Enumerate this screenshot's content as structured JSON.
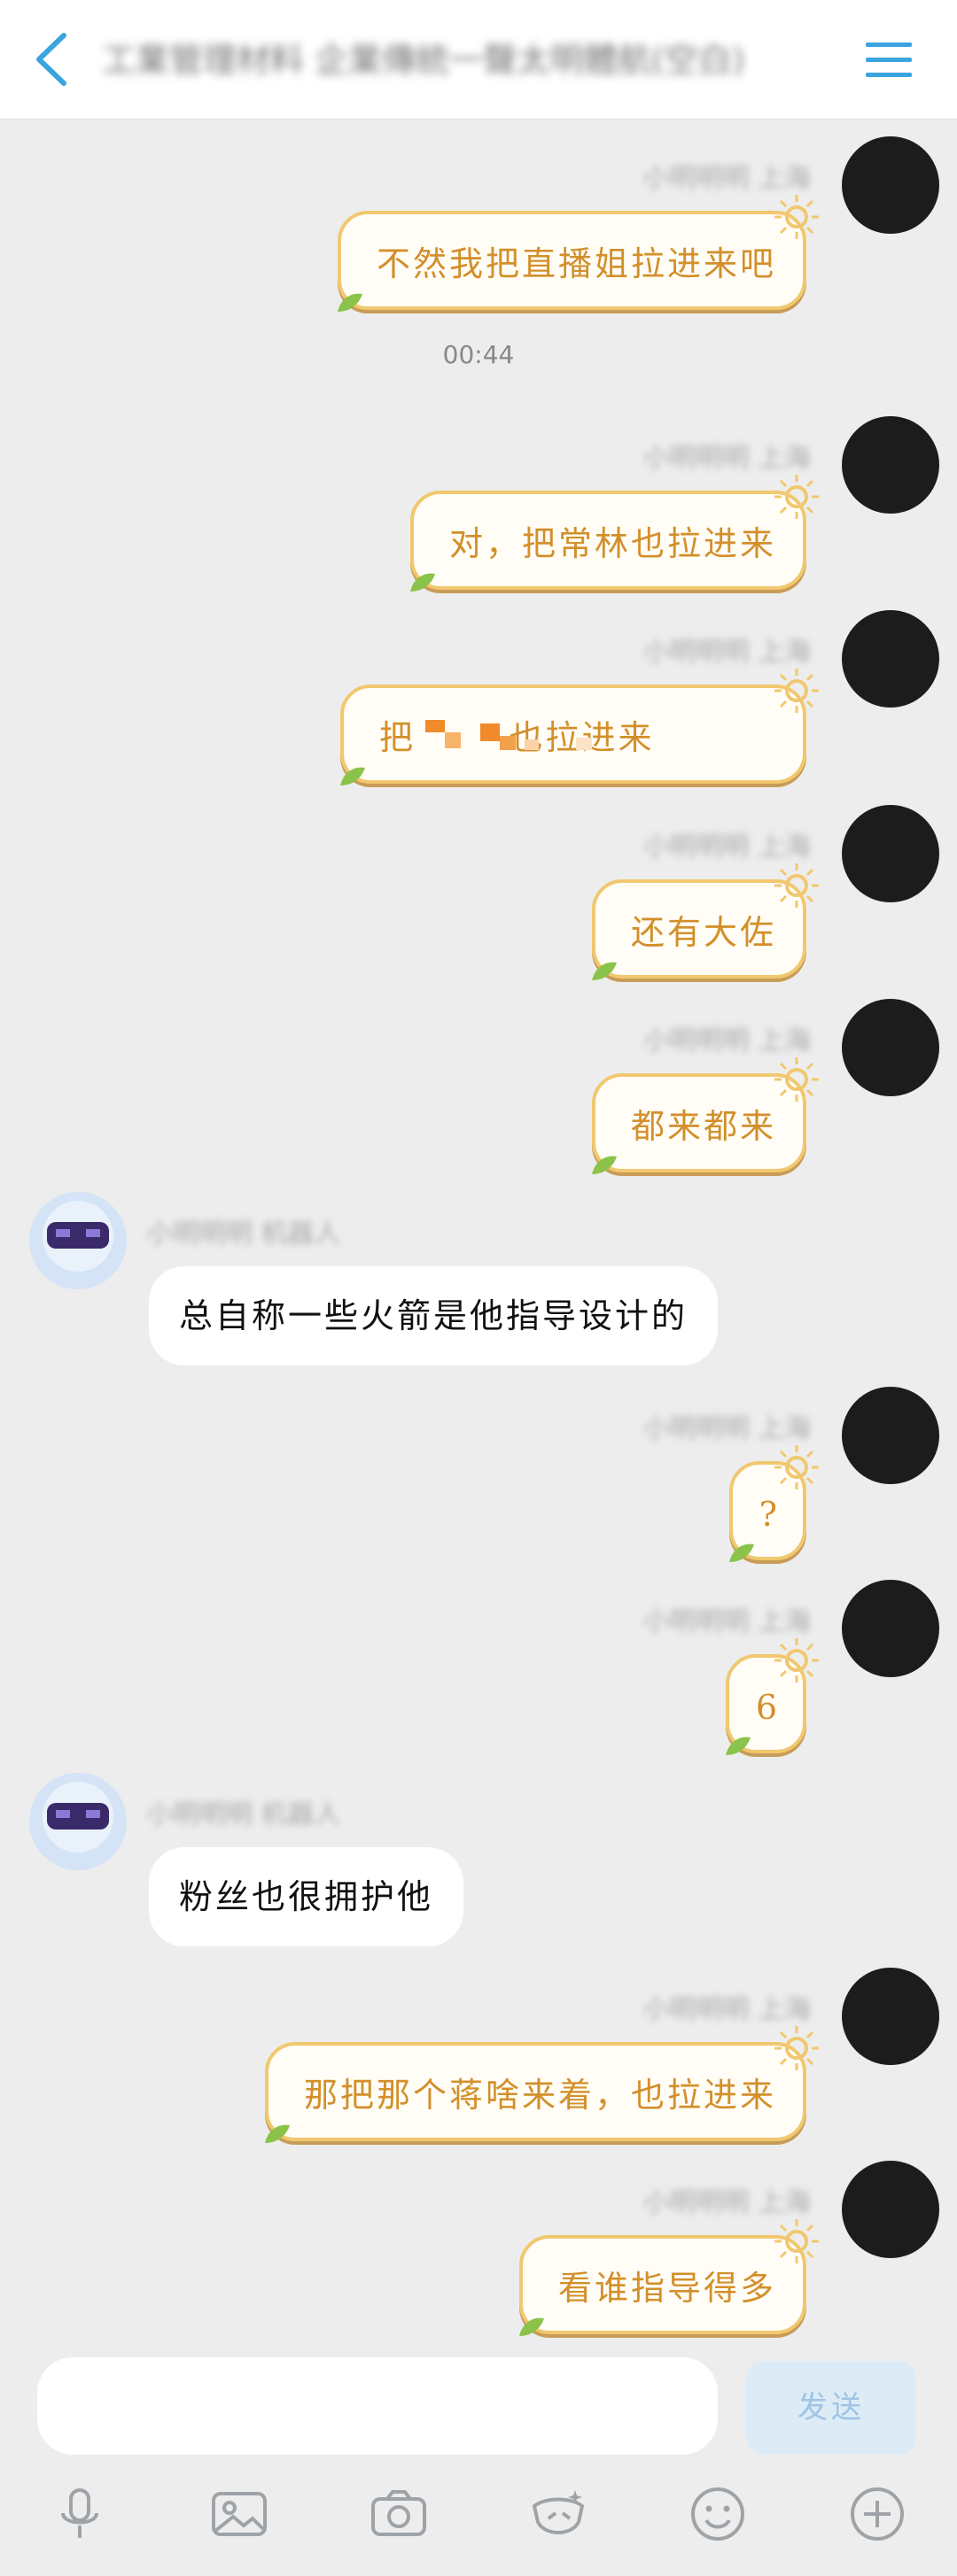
{
  "header": {
    "title": "工業管理材料 企業傳統一聲太明體航(空白)"
  },
  "accent": "#3aa4e0",
  "messages": [
    {
      "side": "me",
      "text": "不然我把直播姐拉进来吧",
      "name": "小明明明 上海"
    },
    {
      "side": "me",
      "text": "对，把常林也拉进来",
      "name": "小明明明 上海"
    },
    {
      "side": "me",
      "text": "把       也拉进来",
      "name": "小明明明 上海",
      "redacted": true
    },
    {
      "side": "me",
      "text": "还有大佐",
      "name": "小明明明 上海"
    },
    {
      "side": "me",
      "text": "都来都来",
      "name": "小明明明 上海"
    },
    {
      "side": "other",
      "text": "总自称一些火箭是他指导设计的",
      "name": "小明明明 机器人"
    },
    {
      "side": "me",
      "text": "?",
      "name": "小明明明 上海"
    },
    {
      "side": "me",
      "text": "6",
      "name": "小明明明 上海"
    },
    {
      "side": "other",
      "text": "粉丝也很拥护他",
      "name": "小明明明 机器人"
    },
    {
      "side": "me",
      "text": "那把那个蒋啥来着，也拉进来",
      "name": "小明明明 上海"
    },
    {
      "side": "me",
      "text": "看谁指导得多",
      "name": "小明明明 上海"
    }
  ],
  "time_divider": "00:44",
  "composer": {
    "send_label": "发送"
  },
  "icons": {
    "back": "back-chevron-icon",
    "menu": "menu-icon",
    "tools": [
      "microphone-icon",
      "image-icon",
      "camera-icon",
      "sticker-icon",
      "emoji-icon",
      "plus-icon"
    ]
  }
}
